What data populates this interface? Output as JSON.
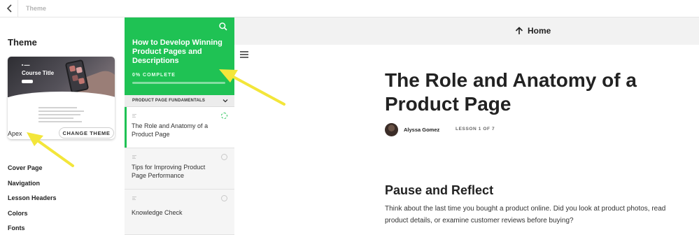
{
  "topbar": {
    "title": "Theme",
    "back_icon": "chevron-left-icon"
  },
  "left_panel": {
    "heading": "Theme",
    "preview": {
      "course_title": "Course Title"
    },
    "theme_name": "Apex",
    "change_button": "CHANGE THEME",
    "menu": [
      "Cover Page",
      "Navigation",
      "Lesson Headers",
      "Colors",
      "Fonts"
    ]
  },
  "course": {
    "title": "How to Develop Winning Product Pages and Descriptions",
    "progress_label": "0% COMPLETE",
    "progress": 0,
    "section": "PRODUCT PAGE FUNDAMENTALS",
    "lessons": [
      {
        "title": "The Role and Anatomy of a Product Page"
      },
      {
        "title": "Tips for Improving Product Page Performance"
      },
      {
        "title": "Knowledge Check"
      }
    ]
  },
  "main": {
    "home_label": "Home",
    "lesson_title": "The Role and Anatomy of a Product Page",
    "author": "Alyssa Gomez",
    "lesson_count": "LESSON 1 OF 7",
    "subheading": "Pause and Reflect",
    "body": "Think about the last time you bought a product online. Did you look at product photos, read product details, or examine customer reviews before buying?"
  },
  "colors": {
    "accent": "#1fc254",
    "arrow": "#f3e63a",
    "header_bg": "#f2f2f2"
  }
}
